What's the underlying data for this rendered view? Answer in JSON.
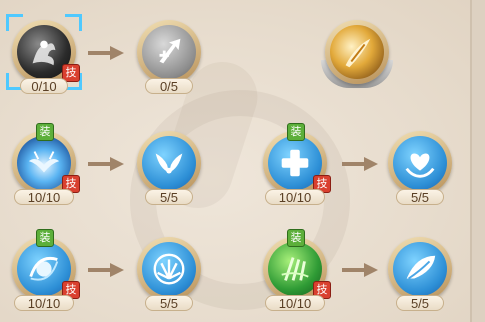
{
  "tags": {
    "skill": "技",
    "equip": "装"
  },
  "colors": {
    "ring": "#d6b27a",
    "counter_text": "#5a3f25",
    "arrow": "#a08469",
    "selection": "#4fc9ff"
  },
  "rows": [
    {
      "left": {
        "icon": "dark-spirit-skill-icon",
        "count": "0/10",
        "has_skill_tag": true,
        "selected": true
      },
      "right": {
        "icon": "heal-upgrade-icon",
        "count": "0/5"
      }
    },
    {
      "left": {
        "icon": "storm-wing-skill-icon",
        "count": "10/10",
        "has_skill_tag": true,
        "has_equip_tag": true
      },
      "right": {
        "icon": "wings-icon",
        "count": "5/5"
      }
    },
    {
      "left": {
        "icon": "blue-vortex-skill-icon",
        "count": "10/10",
        "has_skill_tag": true,
        "has_equip_tag": true
      },
      "right": {
        "icon": "burst-icon",
        "count": "5/5"
      }
    }
  ],
  "right_column": [
    {
      "icon": "golden-feather-icon"
    },
    {
      "left": {
        "icon": "blue-cross-heal-skill-icon",
        "count": "10/10",
        "has_skill_tag": true,
        "has_equip_tag": true
      },
      "right": {
        "icon": "heart-hands-icon",
        "count": "5/5"
      }
    },
    {
      "left": {
        "icon": "green-nature-skill-icon",
        "count": "10/10",
        "has_skill_tag": true,
        "has_equip_tag": true
      },
      "right": {
        "icon": "leaf-wind-icon",
        "count": "5/5"
      }
    }
  ]
}
